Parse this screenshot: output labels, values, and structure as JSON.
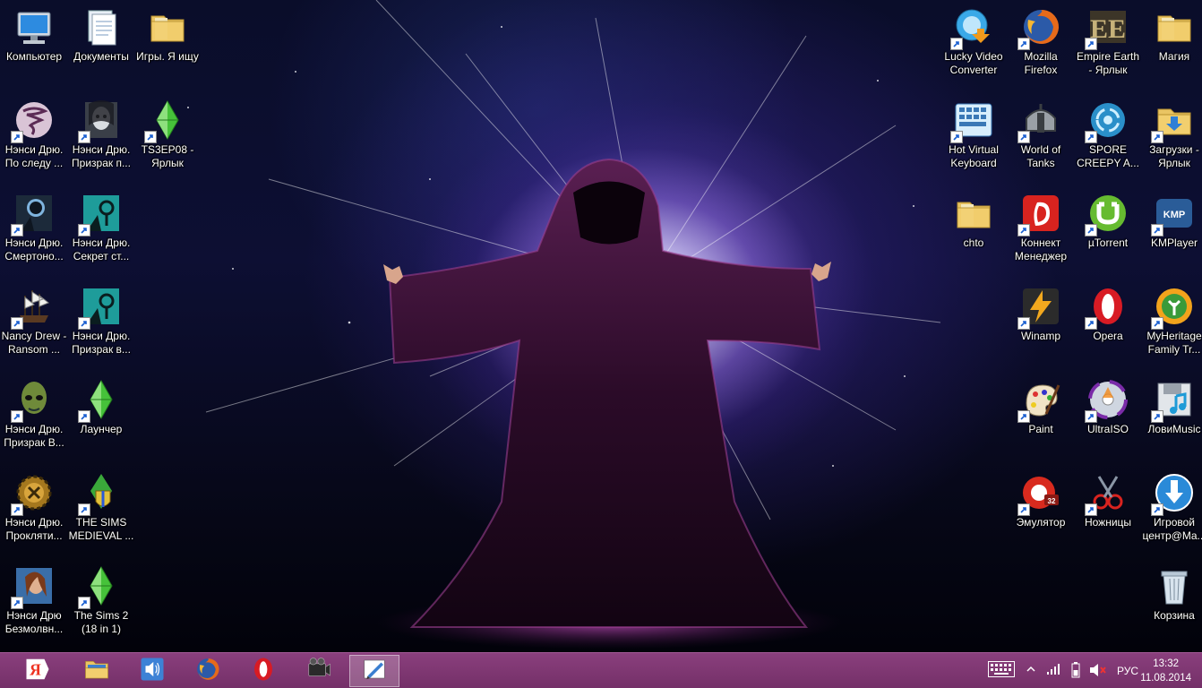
{
  "desktop": {
    "icons": [
      {
        "id": "computer",
        "label": "Компьютер",
        "icon": "computer-icon"
      },
      {
        "id": "documents",
        "label": "Документы",
        "icon": "documents-icon"
      },
      {
        "id": "games-folder",
        "label": "Игры. Я ищу",
        "icon": "folder-icon"
      },
      {
        "id": "nancy-footsteps",
        "label": "Нэнси Дрю. По следу ...",
        "icon": "tornado-icon"
      },
      {
        "id": "nancy-ghost-p",
        "label": "Нэнси Дрю. Призрак п...",
        "icon": "ghost-portrait-icon"
      },
      {
        "id": "ts3ep08",
        "label": "TS3EP08 - Ярлык",
        "icon": "sims-plumbob-icon"
      },
      {
        "id": "nancy-deadly",
        "label": "Нэнси Дрю. Смертоно...",
        "icon": "nancy-shadow-icon"
      },
      {
        "id": "nancy-secret",
        "label": "Нэнси Дрю. Секрет ст...",
        "icon": "nancy-teal-icon"
      },
      {
        "id": "nancy-ransom",
        "label": "Nancy Drew - Ransom ...",
        "icon": "ship-icon"
      },
      {
        "id": "nancy-ghost-v",
        "label": "Нэнси Дрю. Призрак в...",
        "icon": "nancy-teal-icon"
      },
      {
        "id": "nancy-ghost-b",
        "label": "Нэнси Дрю. Призрак В...",
        "icon": "alien-head-icon"
      },
      {
        "id": "launcher",
        "label": "Лаунчер",
        "icon": "sims-plumbob-icon"
      },
      {
        "id": "nancy-curse",
        "label": "Нэнси Дрю. Прокляти...",
        "icon": "gear-emblem-icon"
      },
      {
        "id": "sims-medieval",
        "label": "THE SIMS MEDIEVAL ...",
        "icon": "sims-shield-icon"
      },
      {
        "id": "nancy-silent",
        "label": "Нэнси Дрю Безмолвн...",
        "icon": "nancy-portrait-icon"
      },
      {
        "id": "sims2",
        "label": "The Sims 2 (18 in 1)",
        "icon": "sims-plumbob-icon"
      },
      {
        "id": "lucky-video",
        "label": "Lucky Video Converter",
        "icon": "video-converter-icon"
      },
      {
        "id": "firefox",
        "label": "Mozilla Firefox",
        "icon": "firefox-icon"
      },
      {
        "id": "empire-earth",
        "label": "Empire Earth - Ярлык",
        "icon": "empire-earth-icon"
      },
      {
        "id": "magic",
        "label": "Магия",
        "icon": "folder-icon"
      },
      {
        "id": "hot-keyboard",
        "label": "Hot Virtual Keyboard",
        "icon": "virtual-keyboard-icon"
      },
      {
        "id": "wot",
        "label": "World of Tanks",
        "icon": "tank-helmet-icon"
      },
      {
        "id": "spore",
        "label": "SPORE CREEPY A...",
        "icon": "spore-icon"
      },
      {
        "id": "downloads",
        "label": "Загрузки - Ярлык",
        "icon": "downloads-folder-icon"
      },
      {
        "id": "chto",
        "label": "chto",
        "icon": "folder-icon"
      },
      {
        "id": "connect-manager",
        "label": "Коннект Менеджер",
        "icon": "connect-manager-icon"
      },
      {
        "id": "utorrent",
        "label": "µTorrent",
        "icon": "utorrent-icon"
      },
      {
        "id": "kmplayer",
        "label": "KMPlayer",
        "icon": "kmplayer-icon"
      },
      {
        "id": "winamp",
        "label": "Winamp",
        "icon": "winamp-icon"
      },
      {
        "id": "opera",
        "label": "Opera",
        "icon": "opera-icon"
      },
      {
        "id": "myheritage",
        "label": "MyHeritage Family Tr...",
        "icon": "myheritage-icon"
      },
      {
        "id": "paint",
        "label": "Paint",
        "icon": "paint-palette-icon"
      },
      {
        "id": "ultraiso",
        "label": "UltraISO",
        "icon": "disc-icon"
      },
      {
        "id": "lovimusic",
        "label": "ЛовиMusic",
        "icon": "music-save-icon"
      },
      {
        "id": "emulator",
        "label": "Эмулятор",
        "icon": "emulator-icon"
      },
      {
        "id": "scissors",
        "label": "Ножницы",
        "icon": "scissors-icon"
      },
      {
        "id": "game-center",
        "label": "Игровой центр@Ma...",
        "icon": "download-arrow-icon"
      },
      {
        "id": "recycle-bin",
        "label": "Корзина",
        "icon": "recycle-bin-icon"
      }
    ]
  },
  "taskbar": {
    "pinned": [
      {
        "id": "yandex",
        "icon": "yandex-icon"
      },
      {
        "id": "explorer",
        "icon": "explorer-folder-icon"
      },
      {
        "id": "volume-app",
        "icon": "speaker-app-icon"
      },
      {
        "id": "firefox",
        "icon": "firefox-icon"
      },
      {
        "id": "opera",
        "icon": "opera-icon"
      },
      {
        "id": "media",
        "icon": "film-camera-icon"
      },
      {
        "id": "pen-app",
        "icon": "pen-tablet-icon",
        "active": true
      }
    ],
    "tray": {
      "language": "РУС",
      "time": "13:32",
      "date": "11.08.2014"
    }
  },
  "colors": {
    "taskbar": "#7d3672",
    "accent": "#a25996"
  }
}
